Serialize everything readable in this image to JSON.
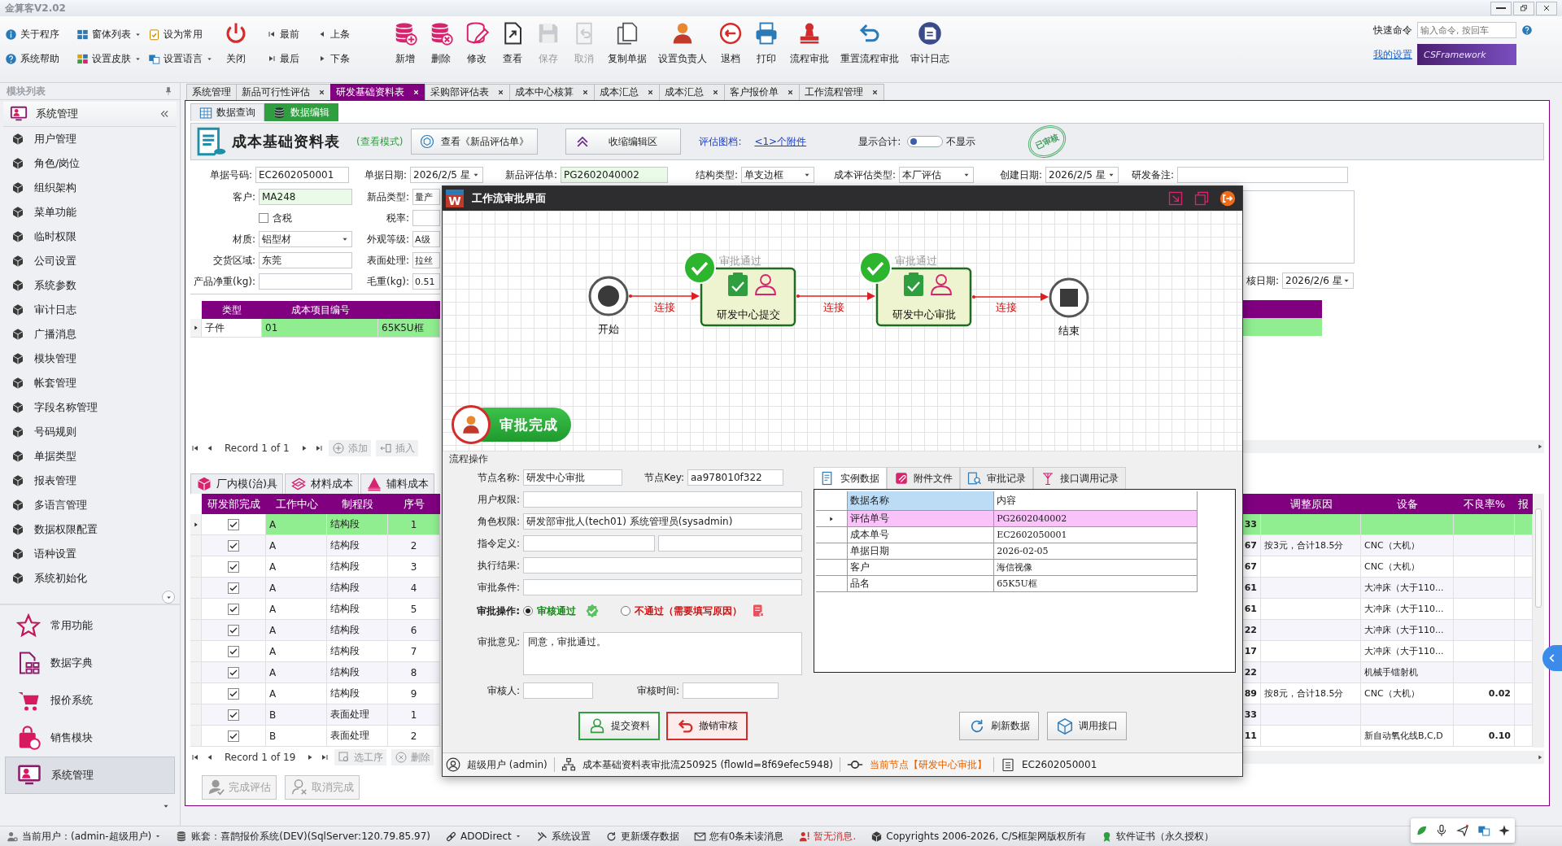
{
  "window": {
    "title": "金算客V2.02"
  },
  "ribbon": {
    "small_buttons": [
      {
        "label": "关于程序",
        "dropdown": false
      },
      {
        "label": "窗体列表",
        "dropdown": true
      },
      {
        "label": "设为常用",
        "dropdown": false
      },
      {
        "label": "系统帮助",
        "dropdown": false
      },
      {
        "label": "设置皮肤",
        "dropdown": true
      },
      {
        "label": "设置语言",
        "dropdown": true
      }
    ],
    "close_button": "关闭",
    "nav_buttons": [
      "最前",
      "上条",
      "最后",
      "下条"
    ],
    "buttons": [
      {
        "label": "新增",
        "disabled": false
      },
      {
        "label": "删除",
        "disabled": false
      },
      {
        "label": "修改",
        "disabled": false
      },
      {
        "label": "查看",
        "disabled": false
      },
      {
        "label": "保存",
        "disabled": true
      },
      {
        "label": "取消",
        "disabled": true
      },
      {
        "label": "复制单据",
        "disabled": false
      },
      {
        "label": "设置负责人",
        "disabled": false
      },
      {
        "label": "退档",
        "disabled": false
      },
      {
        "label": "打印",
        "disabled": false
      },
      {
        "label": "流程审批",
        "disabled": false
      },
      {
        "label": "重置流程审批",
        "disabled": false
      },
      {
        "label": "审计日志",
        "disabled": false
      }
    ],
    "quick_command": {
      "label": "快速命令",
      "placeholder": "输入命令, 按回车"
    },
    "my_settings": "我的设置",
    "logo": "CSFramework"
  },
  "sidebar": {
    "title": "模块列表",
    "group": "系统管理",
    "items": [
      "用户管理",
      "角色/岗位",
      "组织架构",
      "菜单功能",
      "临时权限",
      "公司设置",
      "系统参数",
      "审计日志",
      "广播消息",
      "模块管理",
      "帐套管理",
      "字段名称管理",
      "号码规则",
      "单据类型",
      "报表管理",
      "多语言管理",
      "数据权限配置",
      "语种设置",
      "系统初始化"
    ],
    "modules": [
      {
        "label": "常用功能",
        "selected": false
      },
      {
        "label": "数据字典",
        "selected": false
      },
      {
        "label": "报价系统",
        "selected": false
      },
      {
        "label": "销售模块",
        "selected": false
      },
      {
        "label": "系统管理",
        "selected": true
      }
    ]
  },
  "tabs": [
    {
      "label": "系统管理",
      "selected": false,
      "closable": false
    },
    {
      "label": "新品可行性评估",
      "selected": false,
      "closable": true
    },
    {
      "label": "研发基础资料表",
      "selected": true,
      "closable": true
    },
    {
      "label": "采购部评估表",
      "selected": false,
      "closable": true
    },
    {
      "label": "成本中心核算",
      "selected": false,
      "closable": true
    },
    {
      "label": "成本汇总",
      "selected": false,
      "closable": true
    },
    {
      "label": "成本汇总",
      "selected": false,
      "closable": true
    },
    {
      "label": "客户报价单",
      "selected": false,
      "closable": true
    },
    {
      "label": "工作流程管理",
      "selected": false,
      "closable": true
    }
  ],
  "view_tabs": [
    {
      "label": "数据查询",
      "selected": false
    },
    {
      "label": "数据编辑",
      "selected": true
    }
  ],
  "header": {
    "title": "成本基础资料表",
    "mode": "(查看模式)",
    "view_button": "查看《新品评估单》",
    "collapse_button": "收缩编辑区",
    "attachments_label": "评估图档:",
    "attachments_link": "<1>个附件",
    "total_label": "显示合计:",
    "total_on": false,
    "total_state": "不显示",
    "stamp": "已审核"
  },
  "form": {
    "top_row": [
      {
        "label": "单据号码:",
        "value": "EC2602050001",
        "kind": "text"
      },
      {
        "label": "单据日期:",
        "value": "2026/2/5 星",
        "kind": "dropdown"
      },
      {
        "label": "新品评估单:",
        "value": "PG2602040002",
        "kind": "text",
        "required": true
      },
      {
        "label": "结构类型:",
        "value": "单支边框",
        "kind": "dropdown"
      },
      {
        "label": "成本评估类型:",
        "value": "本厂评估",
        "kind": "dropdown"
      },
      {
        "label": "创建日期:",
        "value": "2026/2/5 星",
        "kind": "dropdown"
      },
      {
        "label": "研发备注:",
        "kind": "text"
      }
    ],
    "rows": [
      [
        {
          "label": "客户:",
          "value": "MA248",
          "kind": "text",
          "required": true
        },
        {
          "label": "新品类型:",
          "value": "量产",
          "kind": "text"
        }
      ],
      [
        {
          "label": "含税",
          "kind": "checkbox",
          "checked": false
        },
        {
          "label": "税率:",
          "kind": "text"
        }
      ],
      [
        {
          "label": "材质:",
          "value": "铝型材",
          "kind": "dropdown"
        },
        {
          "label": "外观等级:",
          "value": "A级",
          "kind": "text"
        }
      ],
      [
        {
          "label": "交货区域:",
          "value": "东莞",
          "kind": "text"
        },
        {
          "label": "表面处理:",
          "value": "拉丝",
          "kind": "text"
        }
      ],
      [
        {
          "label": "产品净重(kg):",
          "kind": "text"
        },
        {
          "label": "毛重(kg):",
          "value": "0.51",
          "kind": "text"
        }
      ]
    ],
    "audit_date": {
      "label": "核日期:",
      "value": "2026/2/6 星",
      "kind": "dropdown"
    }
  },
  "cost_grid": {
    "columns": [
      "类型",
      "成本项目编号"
    ],
    "rows": [
      {
        "type": "子件",
        "code": "01",
        "column_3": "65K5U框",
        "selected": true
      }
    ],
    "navigator": {
      "record": "Record 1 of 1",
      "buttons": [
        "添加",
        "插入"
      ]
    }
  },
  "detail_tabs": [
    "厂内模(治)具",
    "材料成本",
    "辅料成本"
  ],
  "process_grid": {
    "columns": [
      "研发部完成",
      "工作中心",
      "制程段",
      "序号",
      "调整原因",
      "设备",
      "不良率%",
      "报"
    ],
    "rows": [
      {
        "done": true,
        "work_center": "A",
        "stage": "结构段",
        "seq": "1",
        "column_5": "33",
        "selected": true
      },
      {
        "done": true,
        "work_center": "A",
        "stage": "结构段",
        "seq": "2",
        "column_5": "67",
        "reason": "按3元，合计18.5分",
        "equipment": "CNC（大机）",
        "selected": false
      },
      {
        "done": true,
        "work_center": "A",
        "stage": "结构段",
        "seq": "3",
        "column_5": "67",
        "equipment": "CNC（大机）",
        "selected": false
      },
      {
        "done": true,
        "work_center": "A",
        "stage": "结构段",
        "seq": "4",
        "column_5": "61",
        "equipment": "大冲床（大于110...",
        "selected": false
      },
      {
        "done": true,
        "work_center": "A",
        "stage": "结构段",
        "seq": "5",
        "column_5": "61",
        "equipment": "大冲床（大于110...",
        "selected": false
      },
      {
        "done": true,
        "work_center": "A",
        "stage": "结构段",
        "seq": "6",
        "column_5": "22",
        "equipment": "大冲床（大于110...",
        "selected": false
      },
      {
        "done": true,
        "work_center": "A",
        "stage": "结构段",
        "seq": "7",
        "column_5": "17",
        "equipment": "大冲床（大于110...",
        "selected": false
      },
      {
        "done": true,
        "work_center": "A",
        "stage": "结构段",
        "seq": "8",
        "column_5": "22",
        "equipment": "机械手镭射机",
        "selected": false
      },
      {
        "done": true,
        "work_center": "A",
        "stage": "结构段",
        "seq": "9",
        "column_5": "89",
        "reason": "按8元，合计18.5分",
        "equipment": "CNC（大机）",
        "defect_rate": "0.02",
        "selected": false
      },
      {
        "done": true,
        "work_center": "B",
        "stage": "表面处理",
        "seq": "1",
        "column_5": "33",
        "selected": false
      },
      {
        "done": true,
        "work_center": "B",
        "stage": "表面处理",
        "seq": "2",
        "column_5": "11",
        "equipment": "新自动氧化线B,C,D",
        "defect_rate": "0.10",
        "selected": false
      }
    ],
    "navigator": {
      "record": "Record 1 of 19",
      "buttons": [
        "选工序",
        "删除"
      ]
    }
  },
  "actions": [
    {
      "label": "完成评估",
      "disabled": true
    },
    {
      "label": "取消完成",
      "disabled": true
    }
  ],
  "status_bar": [
    {
      "text": "当前用户：(admin-超级用户)",
      "dropdown": true
    },
    {
      "text": "账套：喜鹊报价系统(DEV)(SqlServer:120.79.85.97)",
      "dropdown": false
    },
    {
      "text": "ADODirect",
      "dropdown": true
    },
    {
      "text": "系统设置",
      "dropdown": false
    },
    {
      "text": "更新缓存数据",
      "dropdown": false
    },
    {
      "text": "您有0条未读消息",
      "dropdown": false
    },
    {
      "text": "暂无消息.",
      "dropdown": false,
      "alert": true
    },
    {
      "text": "Copyrights 2006-2026, C/S框架网版权所有",
      "dropdown": false
    },
    {
      "text": "软件证书（永久授权）",
      "dropdown": false
    }
  ],
  "dialog": {
    "logo": "W",
    "title": "工作流审批界面",
    "workflow": {
      "nodes": [
        {
          "kind": "start",
          "label": "开始"
        },
        {
          "kind": "task",
          "label": "研发中心提交",
          "status": "审批通过",
          "approved": true
        },
        {
          "kind": "task",
          "label": "研发中心审批",
          "status": "审批通过",
          "approved": true
        },
        {
          "kind": "end",
          "label": "结束"
        }
      ],
      "links": [
        "连接",
        "连接",
        "连接"
      ]
    },
    "status_badge": "审批完成",
    "process": {
      "title": "流程操作",
      "fields": [
        {
          "label": "节点名称:",
          "value": "研发中心审批"
        },
        {
          "label": "节点Key:",
          "value": "aa978010f322"
        },
        {
          "label": "用户权限:"
        },
        {
          "label": "角色权限:",
          "value": "研发部审批人(tech01) 系统管理员(sysadmin)"
        },
        {
          "label": "指令定义:"
        },
        {
          "label": "执行结果:"
        },
        {
          "label": "审批条件:"
        }
      ],
      "operation": {
        "label": "审批操作:",
        "options": [
          {
            "label": "审核通过",
            "selected": true,
            "color": "#138a13"
          },
          {
            "label": "不通过（需要填写原因）",
            "selected": false,
            "color": "#d01010"
          }
        ]
      },
      "comment": {
        "label": "审批意见:",
        "value": "同意，审批通过。"
      },
      "approver": {
        "label": "审核人:"
      },
      "approve_time": {
        "label": "审核时间:"
      }
    },
    "buttons": [
      {
        "label": "提交资料",
        "kind": "submit"
      },
      {
        "label": "撤销审核",
        "kind": "revoke"
      },
      {
        "label": "刷新数据",
        "kind": "normal"
      },
      {
        "label": "调用接口",
        "kind": "normal"
      }
    ],
    "data_tabs": [
      {
        "label": "实例数据",
        "selected": true
      },
      {
        "label": "附件文件",
        "selected": false
      },
      {
        "label": "审批记录",
        "selected": false
      },
      {
        "label": "接口调用记录",
        "selected": false
      }
    ],
    "data_table": {
      "columns": [
        "数据名称",
        "内容"
      ],
      "rows": [
        {
          "name": "评估单号",
          "value": "PG2602040002",
          "selected": true
        },
        {
          "name": "成本单号",
          "value": "EC2602050001",
          "selected": false
        },
        {
          "name": "单据日期",
          "value": "2026-02-05",
          "selected": false
        },
        {
          "name": "客户",
          "value": "海信视像",
          "selected": false
        },
        {
          "name": "品名",
          "value": "65K5U框",
          "selected": false
        }
      ]
    },
    "status": [
      "超级用户 (admin)",
      "成本基础资料表审批流250925 (flowId=8f69efec5948)",
      "当前节点【研发中心审批】",
      "EC2602050001"
    ]
  }
}
